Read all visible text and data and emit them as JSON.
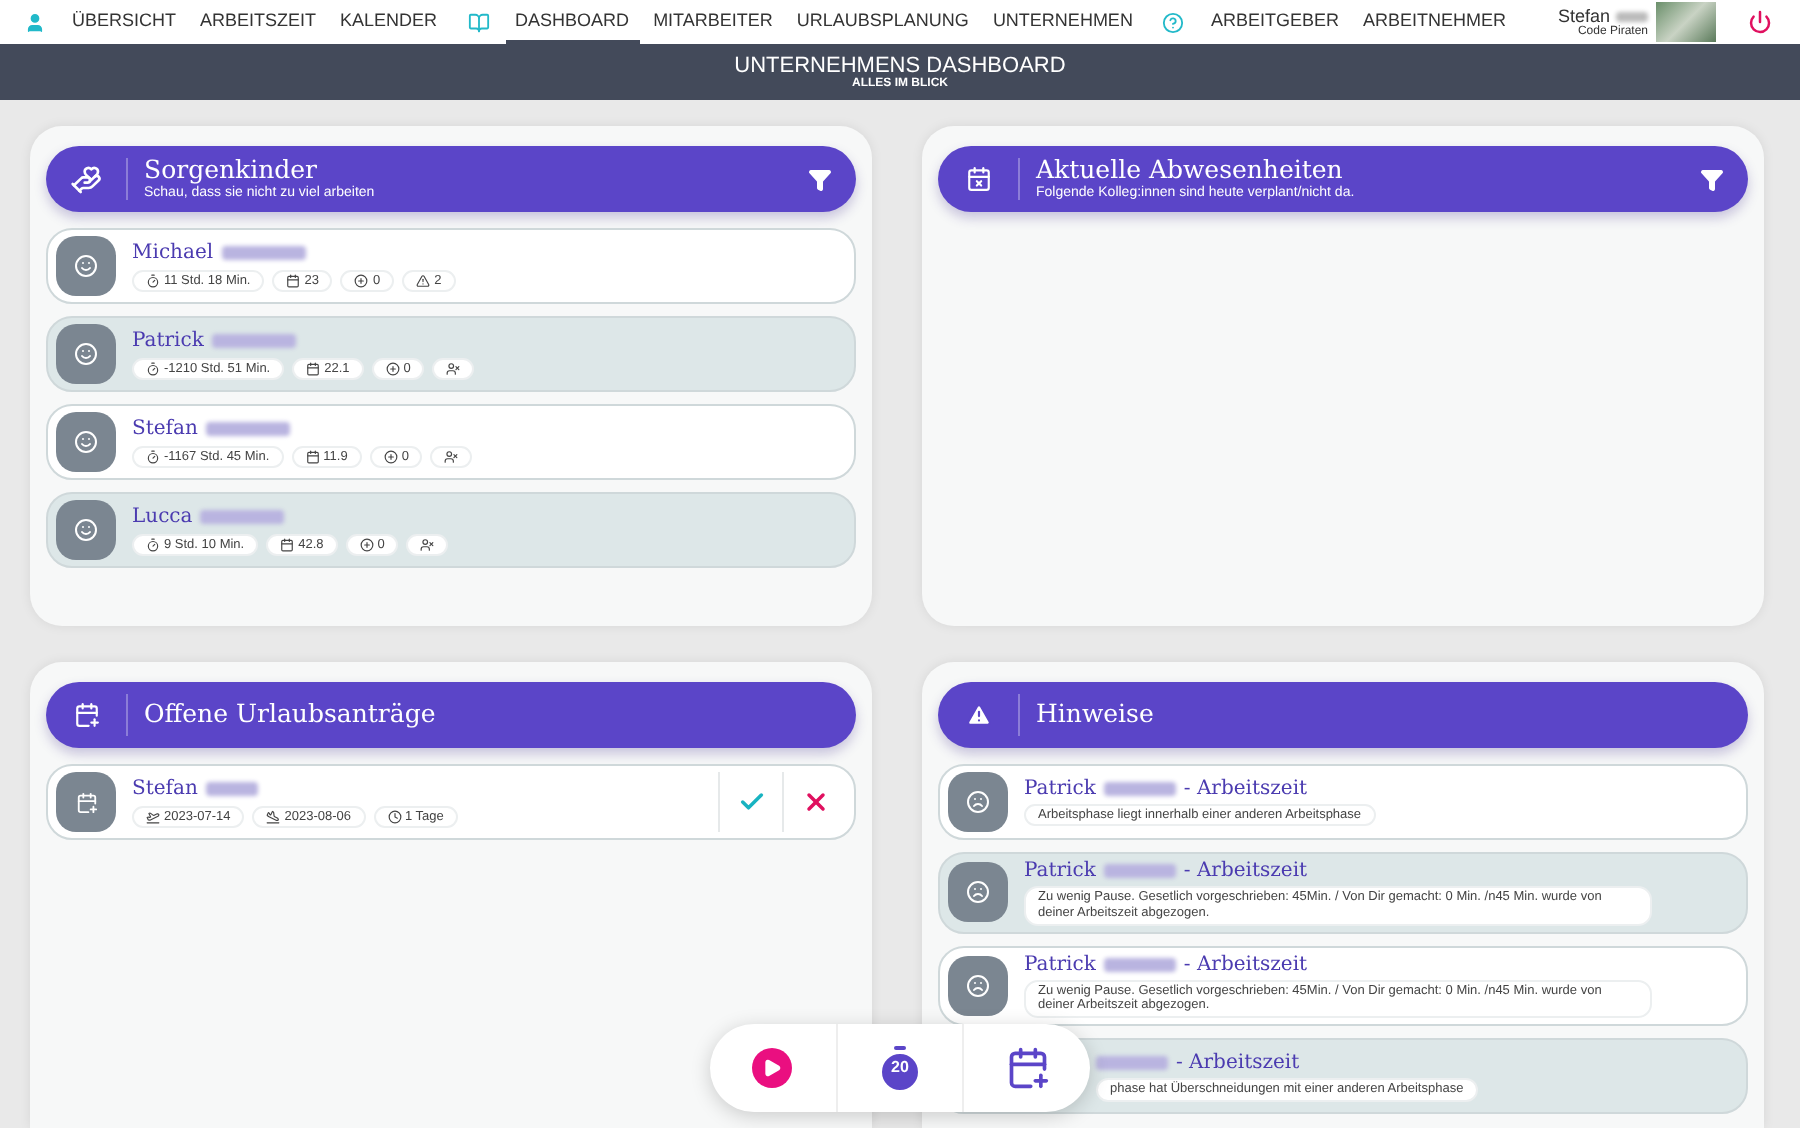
{
  "nav": {
    "groups": [
      {
        "items": [
          {
            "label": "ÜBERSICHT",
            "selected": false
          },
          {
            "label": "ARBEITSZEIT",
            "selected": false
          },
          {
            "label": "KALENDER",
            "selected": false
          }
        ]
      },
      {
        "items": [
          {
            "label": "DASHBOARD",
            "selected": true
          },
          {
            "label": "MITARBEITER",
            "selected": false
          },
          {
            "label": "URLAUBSPLANUNG",
            "selected": false
          },
          {
            "label": "UNTERNEHMEN",
            "selected": false
          }
        ]
      },
      {
        "items": [
          {
            "label": "ARBEITGEBER",
            "selected": false
          },
          {
            "label": "ARBEITNEHMER",
            "selected": false
          }
        ]
      }
    ],
    "user": {
      "name": "Stefan",
      "company": "Code Piraten"
    }
  },
  "header": {
    "title": "UNTERNEHMENS DASHBOARD",
    "subtitle": "ALLES IM BLICK"
  },
  "sorgenkinder": {
    "title": "Sorgenkinder",
    "subtitle": "Schau, dass sie nicht zu viel arbeiten",
    "rows": [
      {
        "name": "Michael",
        "chips": [
          {
            "kind": "timer",
            "text": "11 Std. 18 Min."
          },
          {
            "kind": "calendar",
            "text": "23"
          },
          {
            "kind": "plus",
            "text": "0"
          },
          {
            "kind": "warning",
            "text": "2"
          }
        ]
      },
      {
        "name": "Patrick",
        "chips": [
          {
            "kind": "timer",
            "text": "-1210 Std. 51 Min."
          },
          {
            "kind": "calendar",
            "text": "22.1"
          },
          {
            "kind": "plus",
            "text": "0"
          },
          {
            "kind": "user-off"
          }
        ]
      },
      {
        "name": "Stefan",
        "chips": [
          {
            "kind": "timer",
            "text": "-1167 Std. 45 Min."
          },
          {
            "kind": "calendar",
            "text": "11.9"
          },
          {
            "kind": "plus",
            "text": "0"
          },
          {
            "kind": "user-off"
          }
        ]
      },
      {
        "name": "Lucca",
        "chips": [
          {
            "kind": "timer",
            "text": "9 Std. 10 Min."
          },
          {
            "kind": "calendar",
            "text": "42.8"
          },
          {
            "kind": "plus",
            "text": "0"
          },
          {
            "kind": "user-off"
          }
        ]
      }
    ]
  },
  "abwesenheiten": {
    "title": "Aktuelle Abwesenheiten",
    "subtitle": "Folgende Kolleg:innen sind heute verplant/nicht da."
  },
  "urlaubsantraege": {
    "title": "Offene Urlaubsanträge",
    "rows": [
      {
        "name": "Stefan",
        "chips": [
          {
            "kind": "takeoff",
            "text": "2023-07-14"
          },
          {
            "kind": "landing",
            "text": "2023-08-06"
          },
          {
            "kind": "clock",
            "text": "1 Tage"
          }
        ]
      }
    ]
  },
  "hinweise": {
    "title": "Hinweise",
    "rows": [
      {
        "name": "Patrick",
        "topic": "- Arbeitszeit",
        "message": "Arbeitsphase liegt innerhalb einer anderen Arbeitsphase"
      },
      {
        "name": "Patrick",
        "topic": "- Arbeitszeit",
        "message": "Zu wenig Pause. Gesetlich vorgeschrieben: 45Min. / Von Dir gemacht: 0 Min. /n45 Min. wurde von deiner Arbeitszeit abgezogen."
      },
      {
        "name": "Patrick",
        "topic": "- Arbeitszeit",
        "message": "Zu wenig Pause. Gesetlich vorgeschrieben: 45Min. / Von Dir gemacht: 0 Min. /n45 Min. wurde von deiner Arbeitszeit abgezogen."
      },
      {
        "topic": "- Arbeitszeit",
        "message": "phase hat Überschneidungen mit einer anderen Arbeitsphase"
      }
    ]
  },
  "quickbar": {
    "timer_label": "20"
  }
}
